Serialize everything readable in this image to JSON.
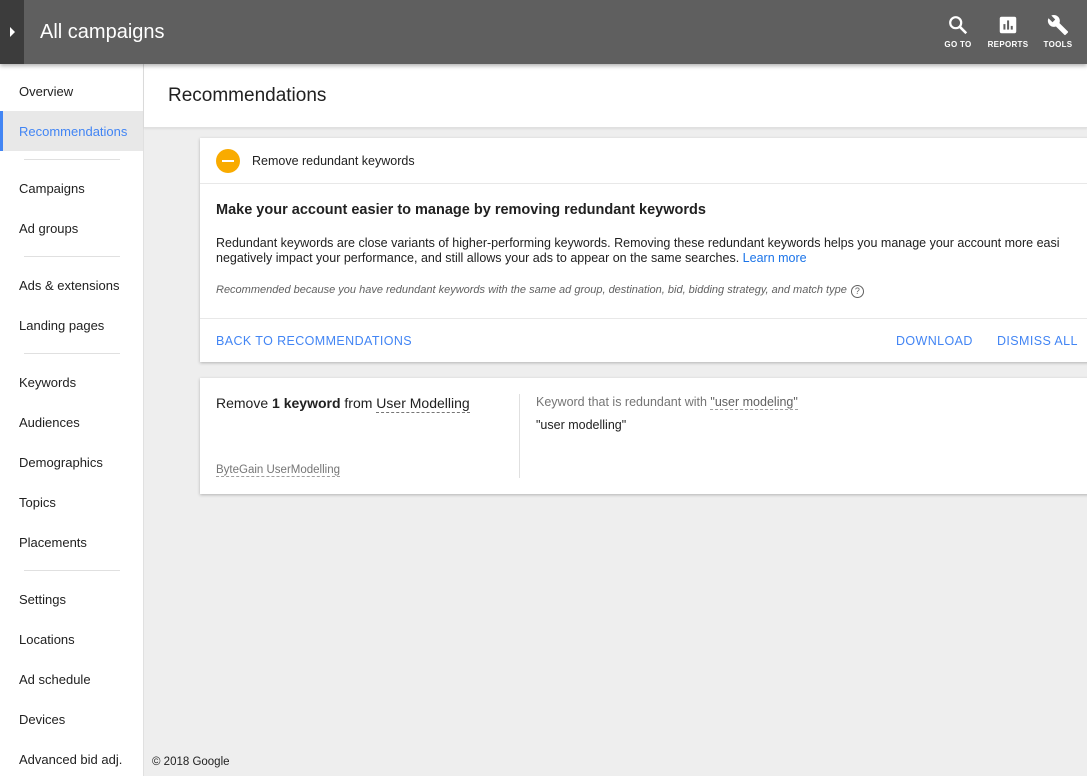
{
  "header": {
    "title": "All campaigns",
    "actions": [
      {
        "label": "GO TO",
        "icon": "search-icon"
      },
      {
        "label": "REPORTS",
        "icon": "reports-icon"
      },
      {
        "label": "TOOLS",
        "icon": "wrench-icon"
      }
    ]
  },
  "sidebar": {
    "active": "Recommendations",
    "items": [
      {
        "label": "Overview"
      },
      {
        "label": "Recommendations"
      },
      {
        "label": "Campaigns"
      },
      {
        "label": "Ad groups"
      },
      {
        "label": "Ads & extensions"
      },
      {
        "label": "Landing pages"
      },
      {
        "label": "Keywords"
      },
      {
        "label": "Audiences"
      },
      {
        "label": "Demographics"
      },
      {
        "label": "Topics"
      },
      {
        "label": "Placements"
      },
      {
        "label": "Settings"
      },
      {
        "label": "Locations"
      },
      {
        "label": "Ad schedule"
      },
      {
        "label": "Devices"
      },
      {
        "label": "Advanced bid adj."
      }
    ]
  },
  "page": {
    "title": "Recommendations"
  },
  "recommendation": {
    "name": "Remove redundant keywords",
    "status_color": "#f9ab00",
    "title": "Make your account easier to manage by removing redundant keywords",
    "description_line1": "Redundant keywords are close variants of higher-performing keywords. Removing these redundant keywords helps you manage your account more easi",
    "description_line2": "negatively impact your performance, and still allows your ads to appear on the same searches.",
    "learn_more": "Learn more",
    "reason": "Recommended because you have redundant keywords with the same ad group, destination, bid, bidding strategy, and match type",
    "help_glyph": "?",
    "back_label": "BACK TO RECOMMENDATIONS",
    "download_label": "DOWNLOAD",
    "dismiss_label": "DISMISS ALL"
  },
  "keyword_card": {
    "prefix": "Remove",
    "count": "1 keyword",
    "from": "from",
    "ad_group": "User Modelling",
    "campaign": "ByteGain UserModelling",
    "redundant_label": "Keyword that is redundant with",
    "redundant_with": "\"user modeling\"",
    "keyword": "\"user modelling\""
  },
  "footer": {
    "copyright": "© 2018 Google"
  },
  "colors": {
    "header_bg": "#5f5f5f",
    "accent": "#4285f4",
    "warning": "#f9ab00"
  }
}
